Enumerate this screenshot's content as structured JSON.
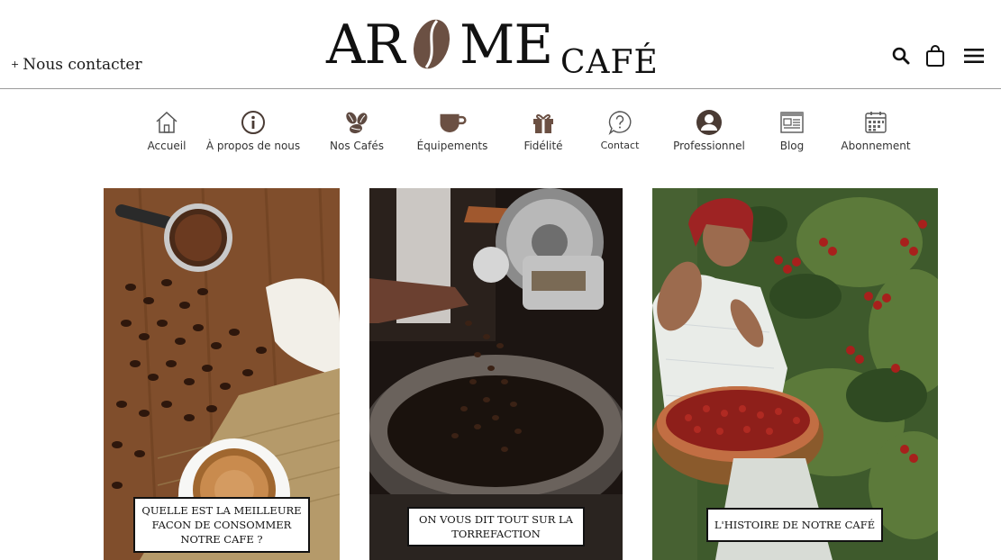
{
  "header": {
    "contact_plus": "+",
    "contact_label": "Nous contacter",
    "logo": {
      "part1": "AR",
      "part2": "ME",
      "part3": "CAFÉ"
    },
    "icons": [
      "search-icon",
      "shopping-bag-icon",
      "hamburger-menu-icon"
    ]
  },
  "nav": {
    "items": [
      {
        "label": "Accueil",
        "icon": "home-icon"
      },
      {
        "label": "À propos de nous",
        "icon": "info-icon"
      },
      {
        "label": "Nos Cafés",
        "icon": "coffee-beans-icon"
      },
      {
        "label": "Équipements",
        "icon": "coffee-cup-icon"
      },
      {
        "label": "Fidélité",
        "icon": "gift-icon"
      },
      {
        "label": "Contact",
        "icon": "question-bubble-icon"
      },
      {
        "label": "Professionnel",
        "icon": "user-circle-icon"
      },
      {
        "label": "Blog",
        "icon": "newspaper-icon"
      },
      {
        "label": "Abonnement",
        "icon": "calendar-icon"
      }
    ]
  },
  "cards": [
    {
      "label": "QUELLE EST LA MEILLEURE FACON DE CONSOMMER NOTRE CAFE ?",
      "image": "coffee-beans-cup-photo"
    },
    {
      "label": "ON VOUS DIT TOUT SUR LA TORREFACTION",
      "image": "coffee-roaster-photo"
    },
    {
      "label": "L'HISTOIRE DE NOTRE CAFÉ",
      "image": "coffee-harvest-photo"
    }
  ],
  "colors": {
    "brown": "#6b5043",
    "text": "#1a1a1a",
    "border": "#111111"
  }
}
